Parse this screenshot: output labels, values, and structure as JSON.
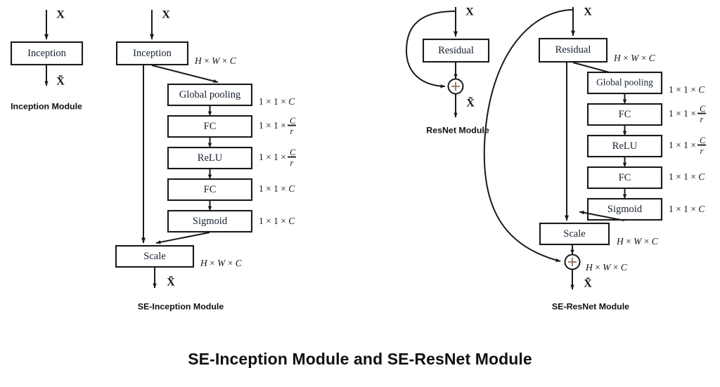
{
  "figure": {
    "caption": "SE-Inception Module and SE-ResNet Module",
    "background_color": "#ffffff",
    "line_color": "#1a1a1a",
    "plus_color": "#8a6a55"
  },
  "modules": [
    {
      "id": "inception-module",
      "caption": "Inception Module",
      "input_label": "X",
      "output_label": "X̃",
      "boxes": [
        {
          "label": "Inception",
          "dim": ""
        }
      ]
    },
    {
      "id": "se-inception-module",
      "caption": "SE-Inception Module",
      "input_label": "X",
      "output_label": "X̃",
      "boxes": [
        {
          "label": "Inception",
          "dim": "H × W × C"
        },
        {
          "label": "Global pooling",
          "dim": "1 × 1 × C"
        },
        {
          "label": "FC",
          "dim": "1 × 1 × C/r"
        },
        {
          "label": "ReLU",
          "dim": "1 × 1 × C/r"
        },
        {
          "label": "FC",
          "dim": "1 × 1 × C"
        },
        {
          "label": "Sigmoid",
          "dim": "1 × 1 × C"
        },
        {
          "label": "Scale",
          "dim": "H × W × C"
        }
      ]
    },
    {
      "id": "resnet-module",
      "caption": "ResNet Module",
      "input_label": "X",
      "output_label": "X̃",
      "boxes": [
        {
          "label": "Residual",
          "dim": ""
        }
      ],
      "sum_node": "+"
    },
    {
      "id": "se-resnet-module",
      "caption": "SE-ResNet Module",
      "input_label": "X",
      "output_label": "X̃",
      "boxes": [
        {
          "label": "Residual",
          "dim": "H × W × C"
        },
        {
          "label": "Global pooling",
          "dim": "1 × 1 × C"
        },
        {
          "label": "FC",
          "dim": "1 × 1 × C/r"
        },
        {
          "label": "ReLU",
          "dim": "1 × 1 × C/r"
        },
        {
          "label": "FC",
          "dim": "1 × 1 × C"
        },
        {
          "label": "Sigmoid",
          "dim": "1 × 1 × C"
        },
        {
          "label": "Scale",
          "dim": "H × W × C"
        }
      ],
      "sum_node": "+",
      "sum_dim": "H × W × C"
    }
  ],
  "labels": {
    "inception": "Inception",
    "residual": "Residual",
    "global_pooling": "Global pooling",
    "fc": "FC",
    "relu": "ReLU",
    "sigmoid": "Sigmoid",
    "scale": "Scale",
    "input_x": "X",
    "output_x_tilde": "X̃"
  },
  "dims": {
    "hwc": "H × W × C",
    "one_one_c": "1 × 1 × C",
    "one_one_c_over_r_prefix": "1 × 1 ×",
    "c": "C",
    "r": "r"
  },
  "captions": {
    "inception_module": "Inception Module",
    "se_inception_module": "SE-Inception Module",
    "resnet_module": "ResNet Module",
    "se_resnet_module": "SE-ResNet Module"
  }
}
